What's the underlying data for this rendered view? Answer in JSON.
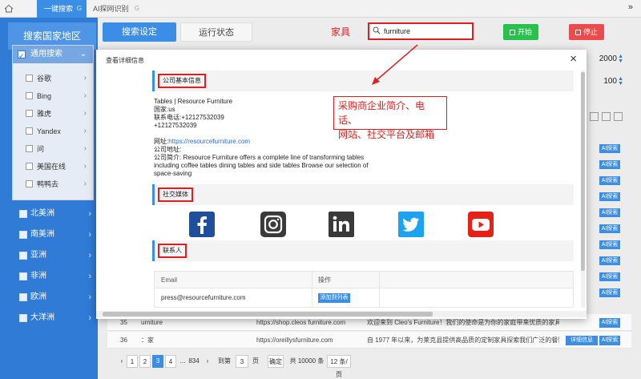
{
  "topbar": {
    "active_tab": "一键搜索",
    "active_tab_mark": "G",
    "tab2": "AI探网识别",
    "tab2_mark": "G",
    "chevron": "»"
  },
  "sidebar": {
    "title": "搜索国家地区",
    "general": "通用搜索",
    "engines": [
      "谷歌",
      "Bing",
      "雅虎",
      "Yandex",
      "问",
      "美国在线",
      "鸭鸭去"
    ],
    "regions": [
      "北美洲",
      "南美洲",
      "亚洲",
      "非洲",
      "欧洲",
      "大洋洲"
    ]
  },
  "controls": {
    "tab_search": "搜索设定",
    "tab_status": "运行状态",
    "annotation_keyword": "家具",
    "search_value": "furniture",
    "start": "开始",
    "stop": "停止",
    "num1": "2000",
    "num2": "100"
  },
  "modal": {
    "title": "查看详细信息",
    "close": "×",
    "section_company": "公司基本信息",
    "company_name": "Tables | Resource Furniture",
    "country": "国家:us",
    "phone_label": "联系电话:+12127532039",
    "phone2": "+12127532039",
    "website_label": "网址:",
    "website": "https://resourcefurniture.com",
    "address": "公司地址:",
    "intro_1": "公司简介: Resource Furniture offers a complete line of transforming tables",
    "intro_2": "including coffee tables dining tables and side tables Browse our selection of",
    "intro_3": "space-saving",
    "section_social": "社交媒体",
    "section_contact": "联系人",
    "col_email": "Email",
    "col_action": "操作",
    "email1": "press@resourcefurniture.com",
    "add_btn": "添加到列表"
  },
  "annotation": {
    "line1": "采购商企业简介、电话、",
    "line2": "网站、社交平台及邮箱"
  },
  "ai_btn": "AI探索",
  "bg_rows": [
    {
      "num": "35",
      "name": "urniture",
      "url": "https://shop.cleos furniture.com",
      "desc": "欢迎来到 Cleo's Furniture！我们的使命是为你的家庭带来优质的家具，就在"
    },
    {
      "num": "36",
      "name": "：家",
      "url": "https://oreillysfurniture.com",
      "desc": "自 1977 年以来，为莱克县提供高品质的定制家具探索我们广泛的餐饮",
      "detail": "详细信息"
    }
  ],
  "pager": {
    "prev": "‹",
    "p1": "1",
    "p2": "2",
    "p3": "3",
    "p4": "4",
    "dots": "...",
    "last": "834",
    "next": "›",
    "goto": "到第",
    "goto_val": "3",
    "page_unit": "页",
    "confirm": "确定",
    "total": "共 10000 条",
    "per_page": "12 条/页"
  }
}
